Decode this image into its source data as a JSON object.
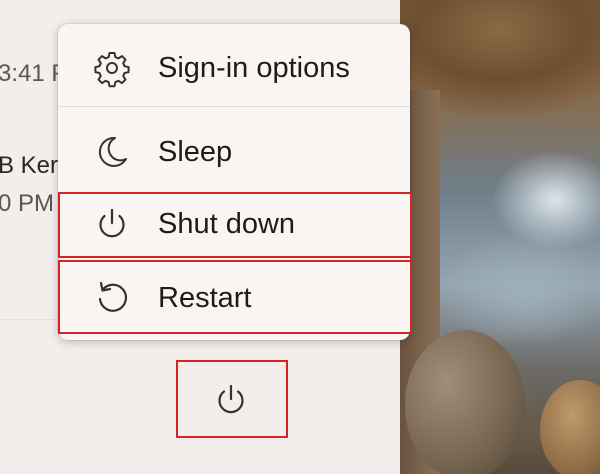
{
  "start_panel": {
    "partial_time_1": "3:41 P",
    "partial_name": "B Ker",
    "partial_time_2": "0 PM"
  },
  "power_menu": {
    "items": [
      {
        "label": "Sign-in options",
        "icon": "gear-icon"
      },
      {
        "label": "Sleep",
        "icon": "moon-icon"
      },
      {
        "label": "Shut down",
        "icon": "power-icon"
      },
      {
        "label": "Restart",
        "icon": "restart-icon"
      }
    ]
  },
  "power_button": {
    "icon": "power-icon"
  },
  "colors": {
    "highlight": "#d42426",
    "menu_background": "#f9f5f3",
    "panel_background": "#f3eeec"
  }
}
